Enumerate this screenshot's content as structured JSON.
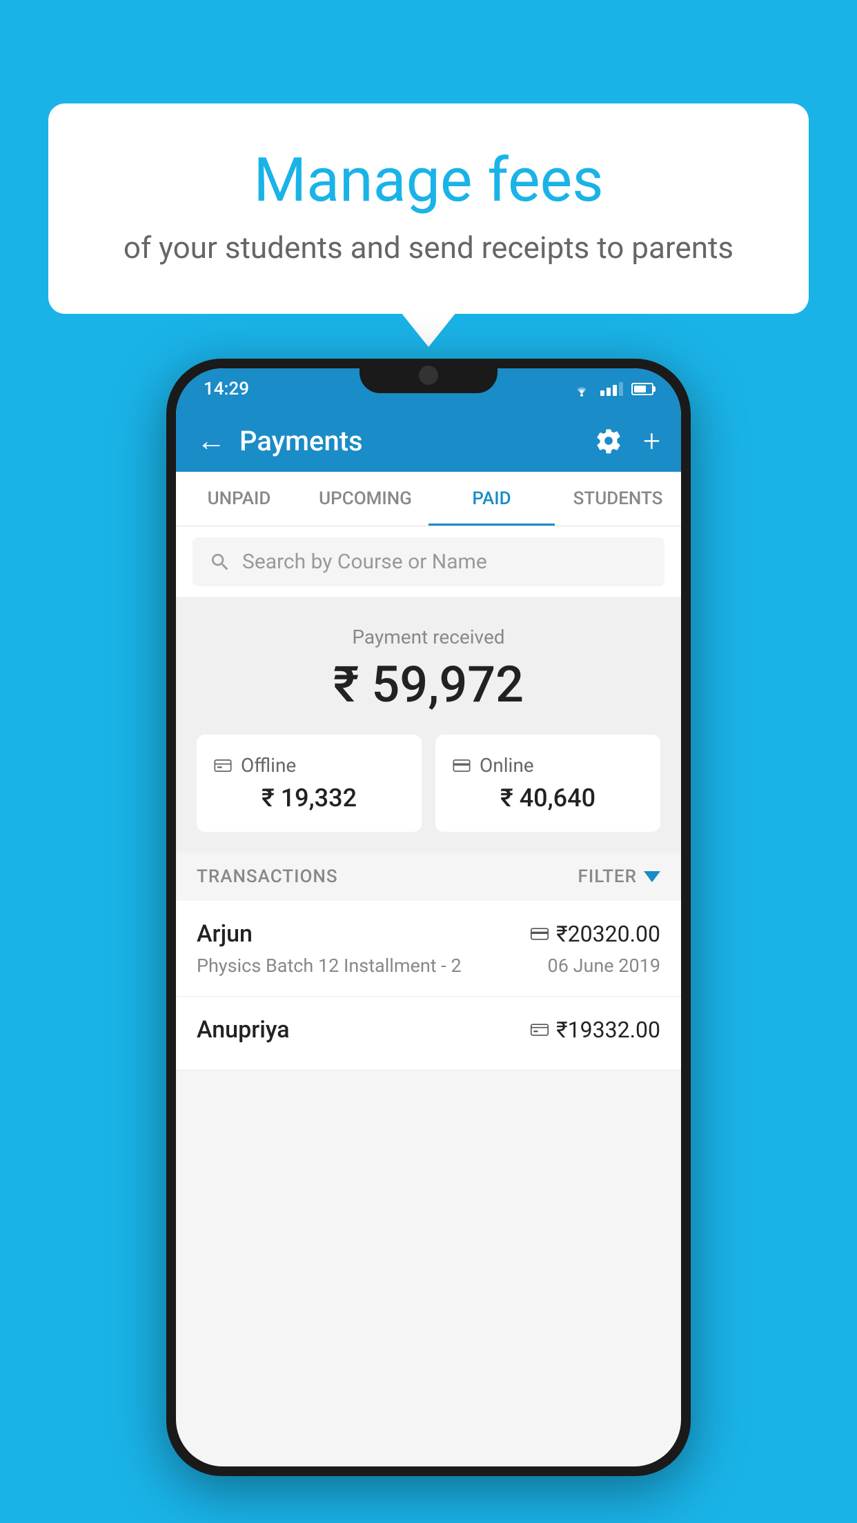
{
  "background_color": "#1ab3e8",
  "speech_bubble": {
    "title": "Manage fees",
    "subtitle": "of your students and send receipts to parents"
  },
  "phone": {
    "status_bar": {
      "time": "14:29"
    },
    "app_bar": {
      "title": "Payments",
      "back_label": "←",
      "plus_label": "+"
    },
    "tabs": [
      {
        "label": "UNPAID",
        "active": false
      },
      {
        "label": "UPCOMING",
        "active": false
      },
      {
        "label": "PAID",
        "active": true
      },
      {
        "label": "STUDENTS",
        "active": false
      }
    ],
    "search": {
      "placeholder": "Search by Course or Name"
    },
    "payment_summary": {
      "label": "Payment received",
      "total": "₹ 59,972",
      "offline_label": "Offline",
      "offline_amount": "₹ 19,332",
      "online_label": "Online",
      "online_amount": "₹ 40,640"
    },
    "transactions": {
      "header": "TRANSACTIONS",
      "filter_label": "FILTER",
      "items": [
        {
          "name": "Arjun",
          "course": "Physics Batch 12 Installment - 2",
          "amount": "₹20320.00",
          "date": "06 June 2019",
          "payment_type": "card"
        },
        {
          "name": "Anupriya",
          "course": "",
          "amount": "₹19332.00",
          "date": "",
          "payment_type": "offline"
        }
      ]
    }
  }
}
